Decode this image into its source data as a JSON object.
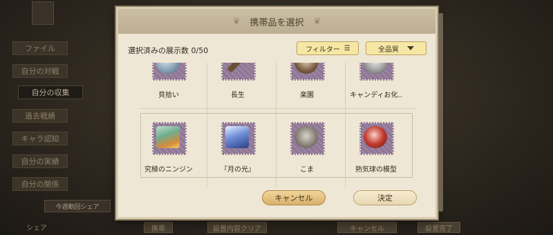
{
  "sidebar": {
    "items": [
      {
        "label": "ファイル",
        "active": false
      },
      {
        "label": "自分の対戦",
        "active": false
      },
      {
        "label": "自分の収集",
        "active": true
      },
      {
        "label": "過去戦績",
        "active": false
      },
      {
        "label": "キャラ認知",
        "active": false
      },
      {
        "label": "自分の実績",
        "active": false
      },
      {
        "label": "自分の関係",
        "active": false
      }
    ]
  },
  "share": {
    "tag": "今週勤回シェア",
    "label": "シェア"
  },
  "background_buttons": {
    "b1": "携帯",
    "b2": "設置内容クリア",
    "b3": "キャンセル",
    "b4": "設置完了"
  },
  "dialog": {
    "title": "携帯品を選択",
    "count_label": "選択済みの展示数 0/50",
    "filter_label": "フィルター",
    "grade_label": "全品質",
    "cancel_label": "キャンセル",
    "confirm_label": "決定"
  },
  "items_row1": [
    {
      "label": "貝拾い",
      "icon": "shell-icon"
    },
    {
      "label": "長生",
      "icon": "staff-icon"
    },
    {
      "label": "楽園",
      "icon": "bell-icon"
    },
    {
      "label": "キャンディお化..",
      "icon": "candy-ghost-icon"
    }
  ],
  "items_row2": [
    {
      "label": "究極のニンジン",
      "icon": "carrot-icon"
    },
    {
      "label": "『月の光』",
      "icon": "moonlight-card-icon"
    },
    {
      "label": "こま",
      "icon": "spinning-top-icon"
    },
    {
      "label": "熱気球の模型",
      "icon": "balloon-model-icon"
    }
  ],
  "colors": {
    "stamp": "#8e7694",
    "dialog_bg": "#efe7d5",
    "button": "#f7e7a5"
  }
}
